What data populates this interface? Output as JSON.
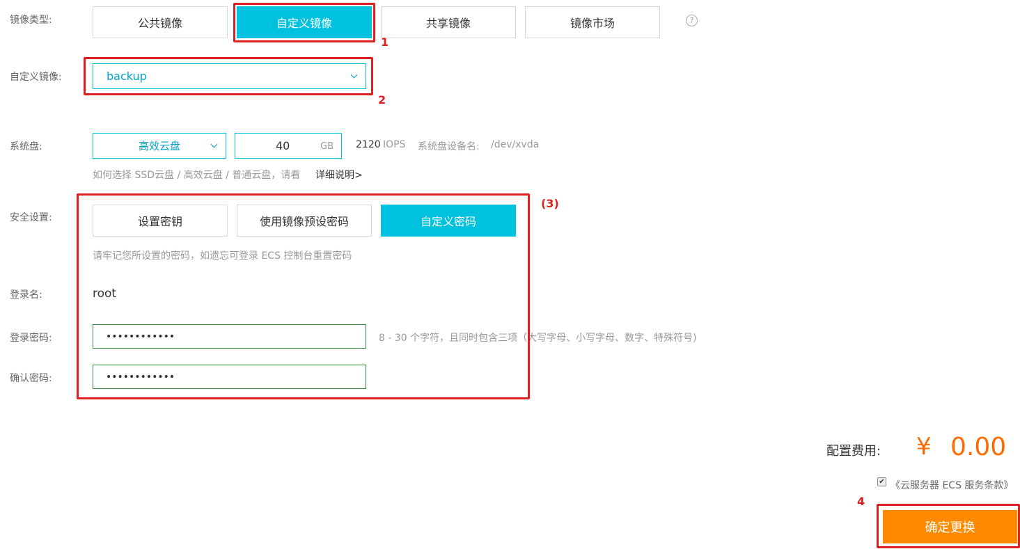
{
  "image_type": {
    "label": "镜像类型:",
    "tabs": [
      {
        "label": "公共镜像",
        "active": false
      },
      {
        "label": "自定义镜像",
        "active": true
      },
      {
        "label": "共享镜像",
        "active": false
      },
      {
        "label": "镜像市场",
        "active": false
      }
    ],
    "help_icon": "question-circle-icon"
  },
  "custom_image": {
    "label": "自定义镜像:",
    "selected": "backup"
  },
  "system_disk": {
    "label": "系统盘:",
    "type_selected": "高效云盘",
    "size": "40",
    "unit": "GB",
    "iops_value": "2120",
    "iops_unit": "IOPS",
    "device_label": "系统盘设备名:",
    "device_name": "/dev/xvda",
    "hint_prefix": "如何选择 SSD云盘 / 高效云盘 / 普通云盘，请看",
    "hint_link": "详细说明>"
  },
  "security": {
    "label": "安全设置:",
    "tabs": [
      {
        "label": "设置密钥",
        "active": false
      },
      {
        "label": "使用镜像预设密码",
        "active": false
      },
      {
        "label": "自定义密码",
        "active": true
      }
    ],
    "note": "请牢记您所设置的密码，如遗忘可登录 ECS 控制台重置密码"
  },
  "login": {
    "name_label": "登录名:",
    "name_value": "root",
    "password_label": "登录密码:",
    "password_value": "••••••••••••",
    "password_hint": "8 - 30 个字符，且同时包含三项（大写字母、小写字母、数字、特殊符号)",
    "confirm_label": "确认密码:",
    "confirm_value": "••••••••••••"
  },
  "fee": {
    "label": "配置费用:",
    "currency": "¥",
    "amount": "0.00"
  },
  "agreement": {
    "checked": true,
    "text": "《云服务器 ECS 服务条款》"
  },
  "confirm_button": "确定更换",
  "annotations": [
    "1",
    "2",
    "(3)",
    "4"
  ],
  "colors": {
    "accent": "#00c1de",
    "annotation_red": "#e02020",
    "price_orange": "#ff6a00",
    "button_orange": "#ff8a00",
    "input_green": "#2e8b3a"
  }
}
